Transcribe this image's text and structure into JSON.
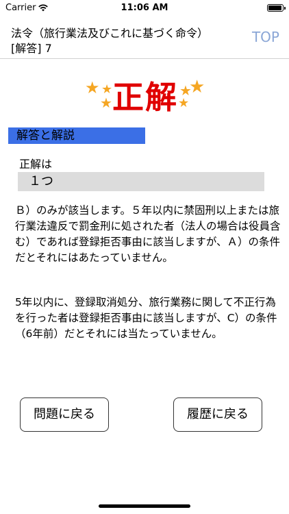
{
  "status_bar": {
    "carrier": "Carrier",
    "time": "11:06 AM"
  },
  "nav": {
    "title": "法令（旅行業法及びこれに基づく命令）",
    "subtitle": "[解答] 7",
    "top_button": "TOP"
  },
  "result": {
    "text": "正解",
    "color": "#e00000",
    "star_color": "#f5a623"
  },
  "section_header": "解答と解説",
  "answer": {
    "label": "正解は",
    "value": "１つ"
  },
  "explanation": {
    "paragraph1": "Ｂ）のみが該当します。５年以内に禁固刑以上または旅行業法違反で罰金刑に処された者（法人の場合は役員含む）であれば登録拒否事由に該当しますが、Ａ）の条件だとそれにはあたっていません。",
    "paragraph2": "5年以内に、登録取消処分、旅行業務に関して不正行為を行った者は登録拒否事由に該当しますが、C）の条件（6年前）だとそれには当たっていません。"
  },
  "buttons": {
    "back_to_question": "問題に戻る",
    "back_to_history": "履歴に戻る"
  },
  "colors": {
    "section_header_bg": "#3b6fe6",
    "top_button": "#8aa6d6",
    "answer_bg": "#dcdcdc"
  }
}
